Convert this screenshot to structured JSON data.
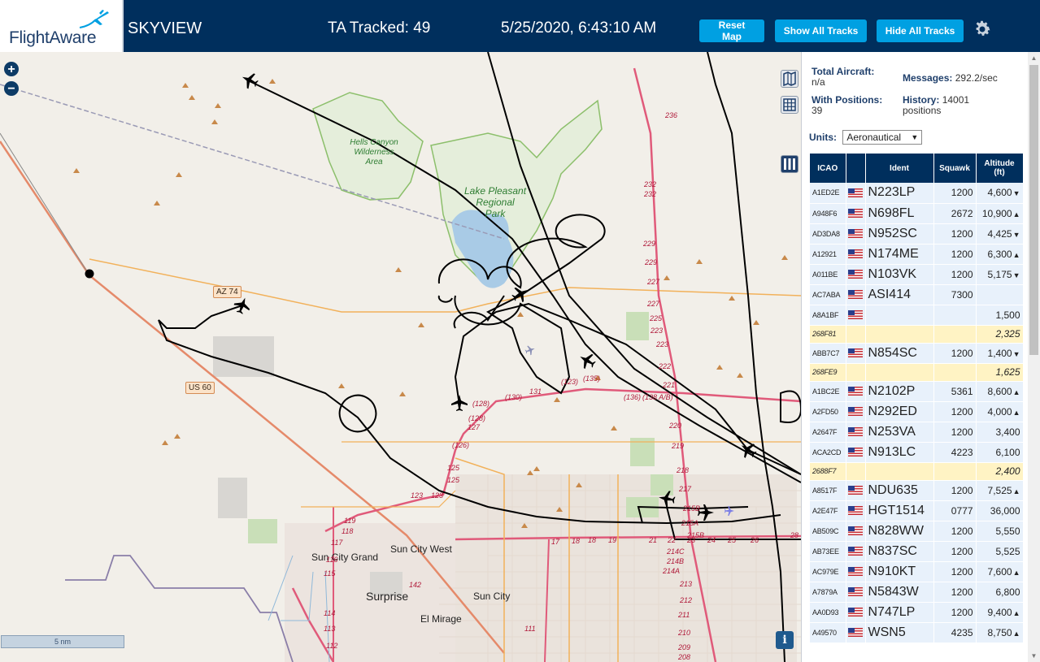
{
  "header": {
    "brand": "FlightAware",
    "app_title": "SKYVIEW",
    "ta_tracked": "TA Tracked: 49",
    "datetime": "5/25/2020, 6:43:10 AM",
    "btn_reset": "Reset Map",
    "btn_show": "Show All Tracks",
    "btn_hide": "Hide All Tracks"
  },
  "map": {
    "zoom_in": "+",
    "zoom_out": "−",
    "scale": "5 nm",
    "info": "i",
    "places": {
      "sun_city_grand": "Sun City Grand",
      "sun_city_west": "Sun City West",
      "surprise": "Surprise",
      "sun_city": "Sun City",
      "el_mirage": "El Mirage"
    },
    "parks": {
      "hells_canyon_1": "Hells Canyon",
      "hells_canyon_2": "Wilderness",
      "hells_canyon_3": "Area",
      "lake_pleasant_1": "Lake Pleasant",
      "lake_pleasant_2": "Regional",
      "lake_pleasant_3": "Park"
    },
    "roads": {
      "az74": "AZ 74",
      "us60": "US 60"
    },
    "miles": [
      "236",
      "232",
      "232",
      "229",
      "229",
      "227",
      "227",
      "225",
      "223",
      "223",
      "222",
      "221",
      "220",
      "219",
      "218",
      "217",
      "215B",
      "215A",
      "215B",
      "214C",
      "214B",
      "214A",
      "213",
      "212",
      "211",
      "210",
      "209",
      "208",
      "(130)",
      "(128)",
      "(128)",
      "(126)",
      "131",
      "127",
      "125",
      "125",
      "123",
      "123",
      "(123)",
      "(135)",
      "(136)",
      "(138 A/B)",
      "119",
      "118",
      "117",
      "116",
      "115",
      "114",
      "113",
      "112",
      "111",
      "142",
      "17",
      "18",
      "18",
      "19",
      "21",
      "22",
      "23",
      "24",
      "25",
      "26",
      "28"
    ]
  },
  "stats": {
    "total_label": "Total Aircraft:",
    "total_value": "n/a",
    "messages_label": "Messages:",
    "messages_value": "292.2/sec",
    "positions_label": "With Positions:",
    "positions_value": "39",
    "history_label": "History:",
    "history_value": "14001",
    "history_unit": "positions",
    "units_label": "Units:",
    "units_value": "Aeronautical"
  },
  "table": {
    "headers": {
      "icao": "ICAO",
      "ident": "Ident",
      "squawk": "Squawk",
      "altitude": "Altitude",
      "altitude_unit": "(ft)"
    },
    "rows": [
      {
        "icao": "A1ED2E",
        "ident": "N223LP",
        "squawk": "1200",
        "alt": "4,600",
        "trend": "▼",
        "flag": true,
        "tisb": false
      },
      {
        "icao": "A948F6",
        "ident": "N698FL",
        "squawk": "2672",
        "alt": "10,900",
        "trend": "▲",
        "flag": true,
        "tisb": false
      },
      {
        "icao": "AD3DA8",
        "ident": "N952SC",
        "squawk": "1200",
        "alt": "4,425",
        "trend": "▼",
        "flag": true,
        "tisb": false
      },
      {
        "icao": "A12921",
        "ident": "N174ME",
        "squawk": "1200",
        "alt": "6,300",
        "trend": "▲",
        "flag": true,
        "tisb": false
      },
      {
        "icao": "A011BE",
        "ident": "N103VK",
        "squawk": "1200",
        "alt": "5,175",
        "trend": "▼",
        "flag": true,
        "tisb": false
      },
      {
        "icao": "AC7ABA",
        "ident": "ASI414",
        "squawk": "7300",
        "alt": "",
        "trend": "",
        "flag": true,
        "tisb": false
      },
      {
        "icao": "A8A1BF",
        "ident": "",
        "squawk": "",
        "alt": "1,500",
        "trend": "",
        "flag": true,
        "tisb": false
      },
      {
        "icao": "268F81",
        "ident": "",
        "squawk": "",
        "alt": "2,325",
        "trend": "",
        "flag": false,
        "tisb": true
      },
      {
        "icao": "ABB7C7",
        "ident": "N854SC",
        "squawk": "1200",
        "alt": "1,400",
        "trend": "▼",
        "flag": true,
        "tisb": false
      },
      {
        "icao": "268FE9",
        "ident": "",
        "squawk": "",
        "alt": "1,625",
        "trend": "",
        "flag": false,
        "tisb": true
      },
      {
        "icao": "A1BC2E",
        "ident": "N2102P",
        "squawk": "5361",
        "alt": "8,600",
        "trend": "▲",
        "flag": true,
        "tisb": false
      },
      {
        "icao": "A2FD50",
        "ident": "N292ED",
        "squawk": "1200",
        "alt": "4,000",
        "trend": "▲",
        "flag": true,
        "tisb": false
      },
      {
        "icao": "A2647F",
        "ident": "N253VA",
        "squawk": "1200",
        "alt": "3,400",
        "trend": "",
        "flag": true,
        "tisb": false
      },
      {
        "icao": "ACA2CD",
        "ident": "N913LC",
        "squawk": "4223",
        "alt": "6,100",
        "trend": "",
        "flag": true,
        "tisb": false
      },
      {
        "icao": "2688F7",
        "ident": "",
        "squawk": "",
        "alt": "2,400",
        "trend": "",
        "flag": false,
        "tisb": true
      },
      {
        "icao": "A8517F",
        "ident": "NDU635",
        "squawk": "1200",
        "alt": "7,525",
        "trend": "▲",
        "flag": true,
        "tisb": false
      },
      {
        "icao": "A2E47F",
        "ident": "HGT1514",
        "squawk": "0777",
        "alt": "36,000",
        "trend": "",
        "flag": true,
        "tisb": false
      },
      {
        "icao": "AB509C",
        "ident": "N828WW",
        "squawk": "1200",
        "alt": "5,550",
        "trend": "",
        "flag": true,
        "tisb": false
      },
      {
        "icao": "AB73EE",
        "ident": "N837SC",
        "squawk": "1200",
        "alt": "5,525",
        "trend": "",
        "flag": true,
        "tisb": false
      },
      {
        "icao": "AC979E",
        "ident": "N910KT",
        "squawk": "1200",
        "alt": "7,600",
        "trend": "▲",
        "flag": true,
        "tisb": false
      },
      {
        "icao": "A7879A",
        "ident": "N5843W",
        "squawk": "1200",
        "alt": "6,800",
        "trend": "",
        "flag": true,
        "tisb": false
      },
      {
        "icao": "AA0D93",
        "ident": "N747LP",
        "squawk": "1200",
        "alt": "9,400",
        "trend": "▲",
        "flag": true,
        "tisb": false
      },
      {
        "icao": "A49570",
        "ident": "WSN5",
        "squawk": "4235",
        "alt": "8,750",
        "trend": "▲",
        "flag": true,
        "tisb": false
      }
    ]
  },
  "colors": {
    "header_bg": "#002f5d",
    "button_bg": "#00a0e2",
    "row_bg": "#e8f1fb",
    "tisb_row_bg": "#fff3c4",
    "map_bg": "#f2efe9",
    "water": "#a9cbe6",
    "park_outline": "#8cbf6b"
  },
  "icons": {
    "gear": "gear-icon",
    "layers": "map-layers-icon",
    "grid": "grid-icon",
    "columns": "columns-icon",
    "aircraft": "aircraft-icon"
  }
}
